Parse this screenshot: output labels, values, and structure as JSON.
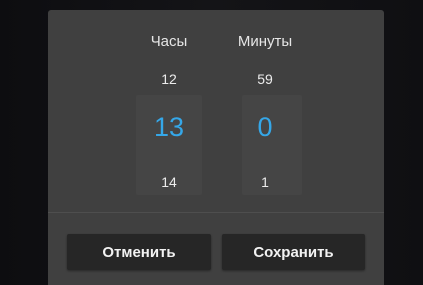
{
  "time_picker": {
    "hours": {
      "label": "Часы",
      "previous": "12",
      "selected": "13",
      "next": "14"
    },
    "minutes": {
      "label": "Минуты",
      "previous": "59",
      "selected": "0",
      "next": "1"
    }
  },
  "buttons": {
    "cancel_label": "Отменить",
    "save_label": "Сохранить"
  },
  "colors": {
    "accent": "#35a7e8",
    "dialog_background": "#404040",
    "button_background": "#262626"
  }
}
